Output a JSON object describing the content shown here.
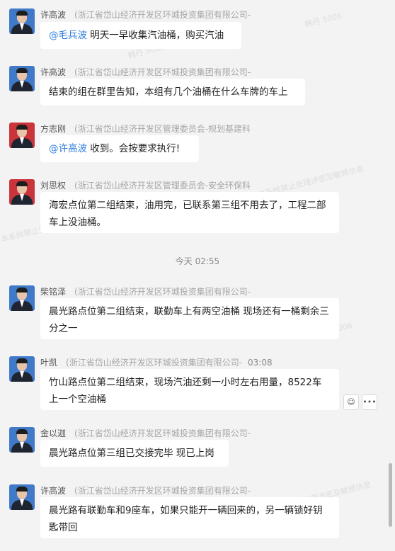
{
  "watermarks": [
    {
      "text": "韩丹 5006",
      "cls": "w1"
    },
    {
      "text": "韩丹 5006",
      "cls": "w2"
    },
    {
      "text": "本系统禁止处理涉密及敏感信息",
      "cls": "w3"
    },
    {
      "text": "本系统禁止处理涉密",
      "cls": "w4"
    },
    {
      "text": "本系统禁止处理涉密及敏感信息",
      "cls": "w5"
    },
    {
      "text": "5006",
      "cls": "w6"
    }
  ],
  "timestamp": "今天 02:55",
  "messages": [
    {
      "name": "许高波",
      "org": "(浙江省岱山经济开发区环城投资集团有限公司-",
      "mention": "@毛兵波",
      "text": " 明天一早收集汽油桶，购买汽油"
    },
    {
      "name": "许高波",
      "org": "(浙江省岱山经济开发区环城投资集团有限公司-",
      "text": "结束的组在群里告知，本组有几个油桶在什么车牌的车上"
    },
    {
      "name": "方志刚",
      "org": "(浙江省岱山经济开发区管理委员会-规划基建科",
      "mention": "@许高波",
      "text": " 收到。会按要求执行!"
    },
    {
      "name": "刘思权",
      "org": "(浙江省岱山经济开发区管理委员会-安全环保科",
      "text": "海宏点位第二组结束，油用完，已联系第三组不用去了，工程二部车上没油桶。"
    },
    {
      "name": "柴铭泽",
      "org": "(浙江省岱山经济开发区环城投资集团有限公司-",
      "text": "晨光路点位第二组结束，联勤车上有两空油桶  现场还有一桶剩余三分之一"
    },
    {
      "name": "叶凯",
      "org": "(浙江省岱山经济开发区环城投资集团有限公司-",
      "time": "03:08",
      "text": "竹山路点位第二组结束，现场汽油还剩一小时左右用量，8522车上一个空油桶"
    },
    {
      "name": "金以迦",
      "org": "(浙江省岱山经济开发区环城投资集团有限公司-",
      "text": "晨光路点位第三组已交接完毕 现已上岗"
    },
    {
      "name": "许高波",
      "org": "(浙江省岱山经济开发区环城投资集团有限公司-",
      "text": "晨光路有联勤车和9座车，如果只能开一辆回来的，另一辆锁好钥匙带回"
    }
  ],
  "actions": {
    "emoji": "☺",
    "more": "•••"
  },
  "icons": {
    "emoji": "smile-icon",
    "more": "more-icon"
  }
}
